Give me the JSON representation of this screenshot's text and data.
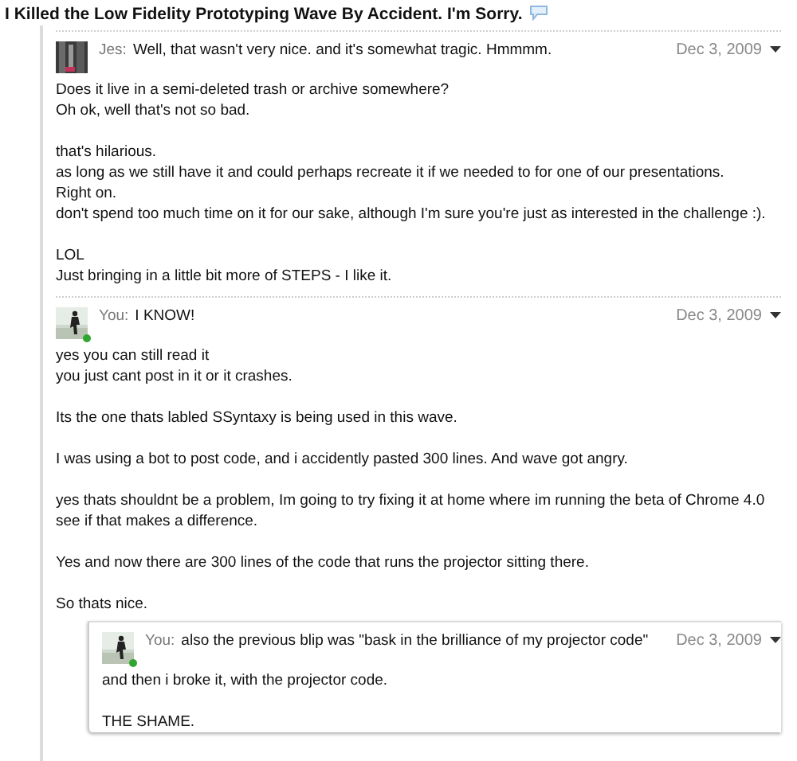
{
  "title": "I Killed the Low Fidelity Prototyping Wave By Accident. I'm Sorry.",
  "blips": [
    {
      "author": "Jes:",
      "message": "Well, that wasn't very nice. and it's somewhat tragic. Hmmmm.",
      "date": "Dec 3, 2009",
      "online": false,
      "paragraphs": [
        [
          "Does it live in a semi-deleted trash or archive somewhere?",
          "Oh ok, well that's not so bad."
        ],
        [
          "that's hilarious.",
          "as long as we still have it and could perhaps recreate it if we needed to for one of our presentations.",
          "Right on.",
          "don't spend too much time on it for our sake, although I'm sure you're just as interested in the challenge :)."
        ],
        [
          "LOL",
          "Just bringing in a little bit more of STEPS - I like it."
        ]
      ]
    },
    {
      "author": "You:",
      "message": "I KNOW!",
      "date": "Dec 3, 2009",
      "online": true,
      "paragraphs": [
        [
          "yes you can still read it",
          "you just cant post in it or it crashes."
        ],
        [
          "Its the one thats labled SSyntaxy is being used in this wave."
        ],
        [
          "I was using a bot to post code, and i accidently pasted 300 lines. And wave got angry."
        ],
        [
          "yes thats shouldnt be a problem, Im going to try fixing it at home where im running the beta of Chrome 4.0",
          "see if that makes a difference."
        ],
        [
          "Yes and now there are 300 lines of the code that runs the projector sitting there."
        ],
        [
          "So thats nice."
        ]
      ],
      "replies": [
        {
          "author": "You:",
          "message": "also the previous blip was \"bask in the brilliance of my projector code\"",
          "date": "Dec 3, 2009",
          "online": true,
          "paragraphs": [
            [
              "and then i broke it, with the projector code."
            ],
            [
              "THE SHAME."
            ]
          ]
        }
      ]
    }
  ]
}
